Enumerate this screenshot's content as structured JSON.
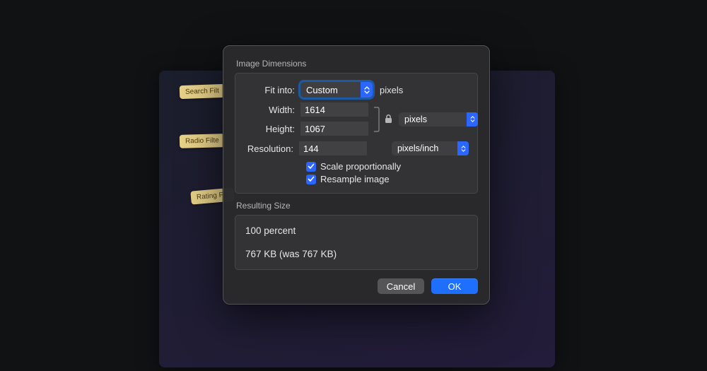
{
  "background_tags": {
    "tag1": "Search Filt",
    "tag2": "Radio Filte",
    "tag3": "Rating Filt"
  },
  "dialog": {
    "sections": {
      "image_dimensions_title": "Image Dimensions",
      "resulting_size_title": "Resulting Size"
    },
    "fit_into": {
      "label": "Fit into:",
      "selected": "Custom",
      "suffix": "pixels"
    },
    "width": {
      "label": "Width:",
      "value": "1614"
    },
    "height": {
      "label": "Height:",
      "value": "1067"
    },
    "wh_units": {
      "selected": "pixels"
    },
    "resolution": {
      "label": "Resolution:",
      "value": "144"
    },
    "resolution_units": {
      "selected": "pixels/inch"
    },
    "scale_proportionally": {
      "label": "Scale proportionally",
      "checked": true
    },
    "resample_image": {
      "label": "Resample image",
      "checked": true
    },
    "result": {
      "percent_line": "100 percent",
      "size_line": "767 KB (was 767 KB)"
    },
    "buttons": {
      "cancel": "Cancel",
      "ok": "OK"
    }
  }
}
